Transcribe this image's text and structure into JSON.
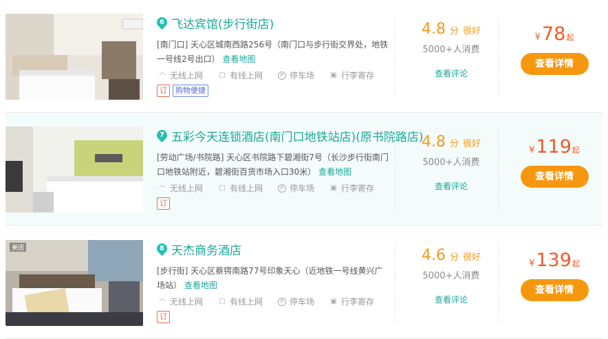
{
  "colors": {
    "accent_teal": "#1aa89a",
    "score_orange": "#f39a1a",
    "price_red": "#f05a2a",
    "button_orange": "#f5980f",
    "highlight_row": "#f3fcfb"
  },
  "hotels": [
    {
      "index": "6",
      "name": "飞达宾馆(步行街店)",
      "address": "[南门口] 天心区城南西路256号（南门口与步行街交界处，地铁一号线2号出口）",
      "map_link": "查看地图",
      "facilities": [
        {
          "icon": "wifi-icon",
          "label": "无线上网"
        },
        {
          "icon": "monitor-icon",
          "label": "有线上网"
        },
        {
          "icon": "parking-icon",
          "label": "停车场"
        },
        {
          "icon": "luggage-icon",
          "label": "行李寄存"
        }
      ],
      "tags": [
        "订",
        "购物便捷"
      ],
      "score": "4.8",
      "score_unit": "分",
      "score_word": "很好",
      "consumers": "5000+人消费",
      "review_link": "查看评论",
      "currency": "¥",
      "price": "78",
      "price_suffix": "起",
      "button": "查看详情"
    },
    {
      "index": "7",
      "name": "五彩今天连锁酒店(南门口地铁站店)(原书院路店)",
      "address": "[劳动广场/书院路] 天心区书院路下碧湘街7号（长沙步行街南门口地铁站附近，碧湘街百货市场入口30米）",
      "map_link": "查看地图",
      "facilities": [
        {
          "icon": "wifi-icon",
          "label": "无线上网"
        },
        {
          "icon": "monitor-icon",
          "label": "有线上网"
        },
        {
          "icon": "parking-icon",
          "label": "停车场"
        },
        {
          "icon": "luggage-icon",
          "label": "行李寄存"
        }
      ],
      "tags": [
        "订"
      ],
      "score": "4.8",
      "score_unit": "分",
      "score_word": "很好",
      "consumers": "5000+人消费",
      "review_link": "查看评论",
      "currency": "¥",
      "price": "119",
      "price_suffix": "起",
      "button": "查看详情"
    },
    {
      "index": "8",
      "name": "天杰商务酒店",
      "address": "[步行街] 天心区蔡锷南路77号印象天心（近地铁一号线黄兴广场站）",
      "map_link": "查看地图",
      "facilities": [
        {
          "icon": "wifi-icon",
          "label": "无线上网"
        },
        {
          "icon": "monitor-icon",
          "label": "有线上网"
        },
        {
          "icon": "parking-icon",
          "label": "停车场"
        },
        {
          "icon": "luggage-icon",
          "label": "行李寄存"
        }
      ],
      "tags": [
        "订"
      ],
      "score": "4.6",
      "score_unit": "分",
      "score_word": "很好",
      "consumers": "5000+人消费",
      "review_link": "查看评论",
      "currency": "¥",
      "price": "139",
      "price_suffix": "起",
      "button": "查看详情",
      "photo_watermark": "美团"
    }
  ]
}
